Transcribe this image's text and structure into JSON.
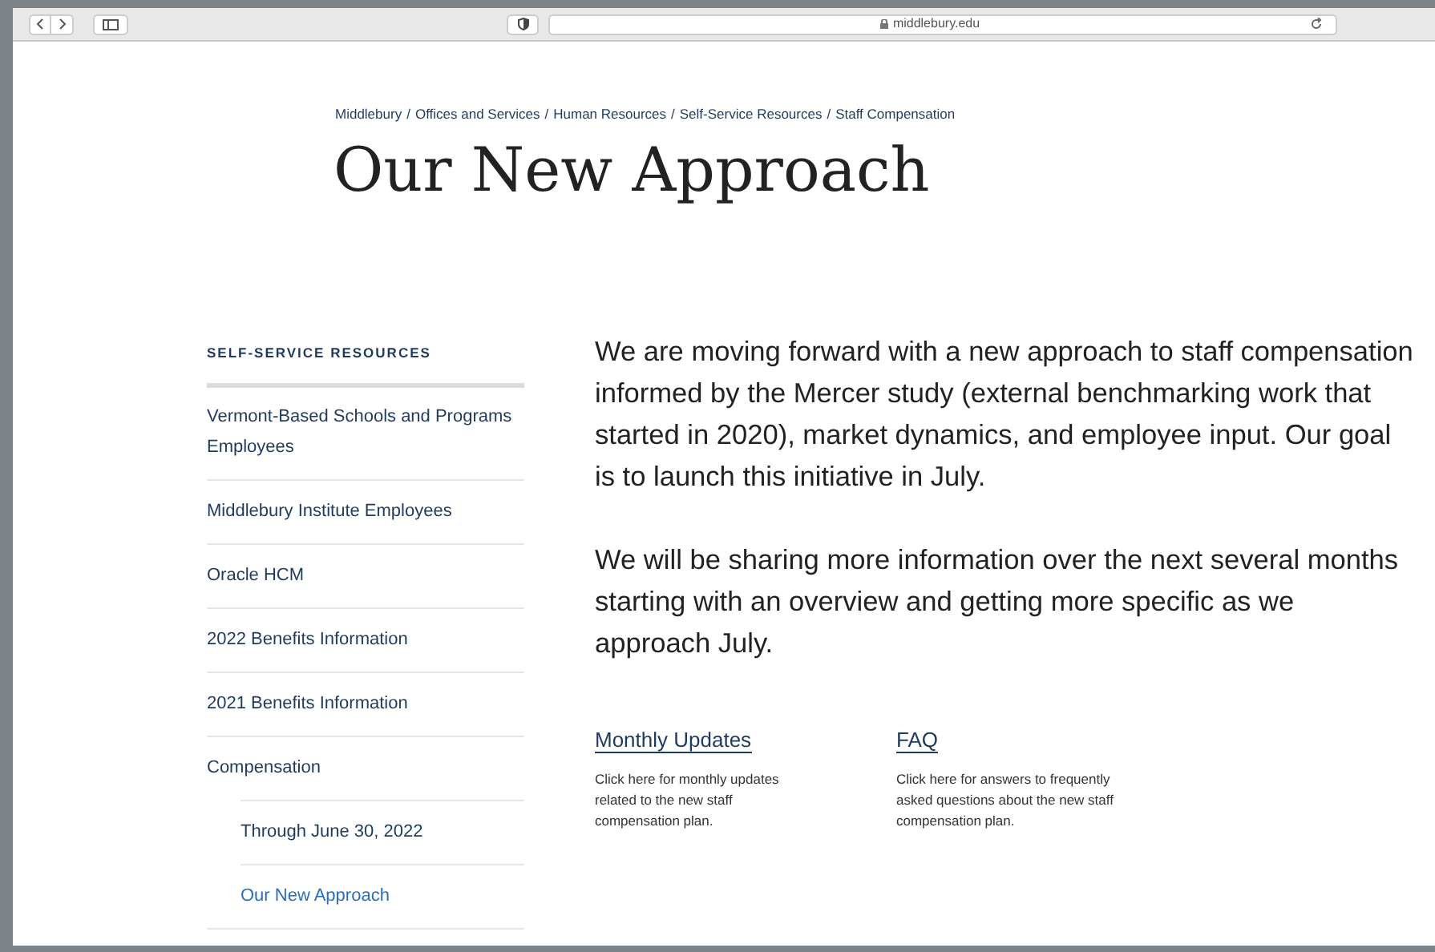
{
  "browser": {
    "address": "middlebury.edu"
  },
  "breadcrumb": {
    "separator": "/",
    "items": [
      "Middlebury",
      "Offices and Services",
      "Human Resources",
      "Self-Service Resources",
      "Staff Compensation"
    ]
  },
  "title": "Our New Approach",
  "sidebar": {
    "heading": "SELF-SERVICE RESOURCES",
    "items": [
      {
        "label": "Vermont-Based Schools and Programs Employees",
        "selected": false
      },
      {
        "label": "Middlebury Institute Employees",
        "selected": false
      },
      {
        "label": "Oracle HCM",
        "selected": false
      },
      {
        "label": "2022 Benefits Information",
        "selected": false
      },
      {
        "label": "2021 Benefits Information",
        "selected": false
      },
      {
        "label": "Compensation",
        "selected": false,
        "children": [
          {
            "label": "Through June 30, 2022",
            "selected": false
          },
          {
            "label": "Our New Approach",
            "selected": true
          }
        ]
      }
    ]
  },
  "paragraphs": [
    "We are moving forward with a new approach to staff compensation informed by the Mercer study (external benchmarking work that started in 2020), market dynamics, and employee input. Our goal is to launch this initiative in July.",
    "We will be sharing more information over the next several months starting with an overview and getting more specific as we approach July."
  ],
  "links": [
    {
      "title": "Monthly Updates",
      "description": "Click here for monthly updates related to the new staff compensation plan."
    },
    {
      "title": "FAQ",
      "description": "Click here for answers to frequently asked questions about the new staff compensation plan."
    }
  ]
}
